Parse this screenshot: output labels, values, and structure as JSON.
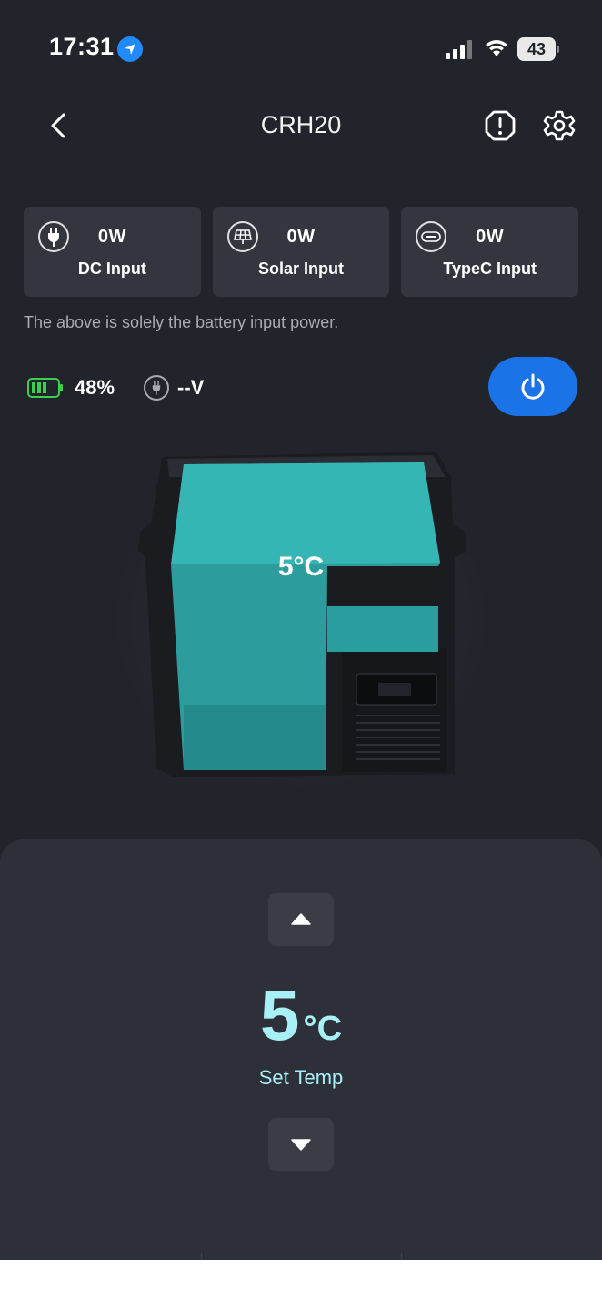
{
  "status_bar": {
    "time": "17:31",
    "battery": "43"
  },
  "header": {
    "title": "CRH20"
  },
  "inputs": [
    {
      "value": "0W",
      "label": "DC Input",
      "icon": "plug-icon"
    },
    {
      "value": "0W",
      "label": "Solar Input",
      "icon": "solar-panel-icon"
    },
    {
      "value": "0W",
      "label": "TypeC Input",
      "icon": "usb-c-icon"
    }
  ],
  "note": "The above is solely the battery input power.",
  "battery": {
    "percent": "48%",
    "voltage": "--V",
    "level": 0.48
  },
  "fridge": {
    "temp": "5°C"
  },
  "control": {
    "value": "5",
    "unit": "°C",
    "label": "Set Temp"
  },
  "colors": {
    "accent": "#1b73e8",
    "cyan": "#a6f0f6",
    "battery_green": "#3ccf4e"
  }
}
